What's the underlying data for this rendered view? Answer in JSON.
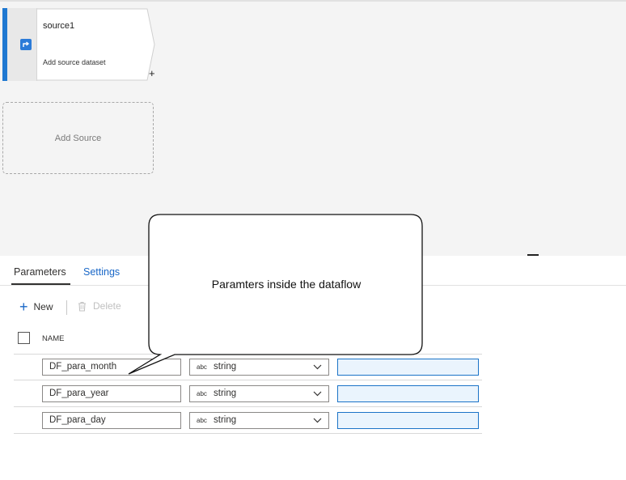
{
  "canvas": {
    "source_node": {
      "title": "source1",
      "subtitle": "Add source dataset",
      "add_glyph": "+",
      "icon": "source-transform-icon"
    },
    "add_source_label": "Add Source"
  },
  "panel": {
    "tabs": [
      {
        "label": "Parameters",
        "active": true
      },
      {
        "label": "Settings",
        "active": false
      }
    ],
    "toolbar": {
      "new_label": "New",
      "delete_label": "Delete"
    },
    "table": {
      "header_name": "NAME",
      "rows": [
        {
          "name": "DF_para_month",
          "type_prefix": "abc",
          "type": "string",
          "default": ""
        },
        {
          "name": "DF_para_year",
          "type_prefix": "abc",
          "type": "string",
          "default": ""
        },
        {
          "name": "DF_para_day",
          "type_prefix": "abc",
          "type": "string",
          "default": ""
        }
      ]
    }
  },
  "callout": {
    "text": "Paramters inside the dataflow"
  },
  "colors": {
    "accent": "#1f78d1",
    "link": "#1967c7",
    "input_focus": "#1b73c7"
  }
}
